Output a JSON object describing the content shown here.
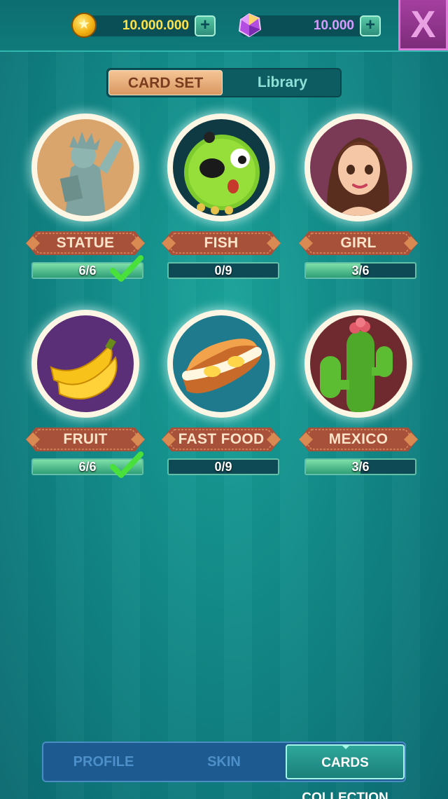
{
  "currencies": {
    "coins": {
      "value": "10.000.000",
      "icon": "coin-icon",
      "add": "+"
    },
    "gems": {
      "value": "10.000",
      "icon": "gem-icon",
      "add": "+"
    }
  },
  "close": {
    "label": "X"
  },
  "tabs": [
    {
      "label": "CARD SET",
      "active": true
    },
    {
      "label": "Library",
      "active": false
    }
  ],
  "cards": [
    {
      "name": "STATUE",
      "progress": "6/6",
      "collected": 6,
      "total": 6,
      "complete": true,
      "icon": "statue-icon"
    },
    {
      "name": "FISH",
      "progress": "0/9",
      "collected": 0,
      "total": 9,
      "complete": false,
      "icon": "pufferfish-icon"
    },
    {
      "name": "GIRL",
      "progress": "3/6",
      "collected": 3,
      "total": 6,
      "complete": false,
      "icon": "girl-icon"
    },
    {
      "name": "FRUIT",
      "progress": "6/6",
      "collected": 6,
      "total": 6,
      "complete": true,
      "icon": "banana-icon"
    },
    {
      "name": "FAST FOOD",
      "progress": "0/9",
      "collected": 0,
      "total": 9,
      "complete": false,
      "icon": "sandwich-icon"
    },
    {
      "name": "MEXICO",
      "progress": "3/6",
      "collected": 3,
      "total": 6,
      "complete": false,
      "icon": "cactus-icon"
    }
  ],
  "nav": [
    {
      "label": "PROFILE",
      "active": false
    },
    {
      "label": "SKIN",
      "active": false
    },
    {
      "label": "CARDS COLLECTION",
      "active": true
    }
  ]
}
